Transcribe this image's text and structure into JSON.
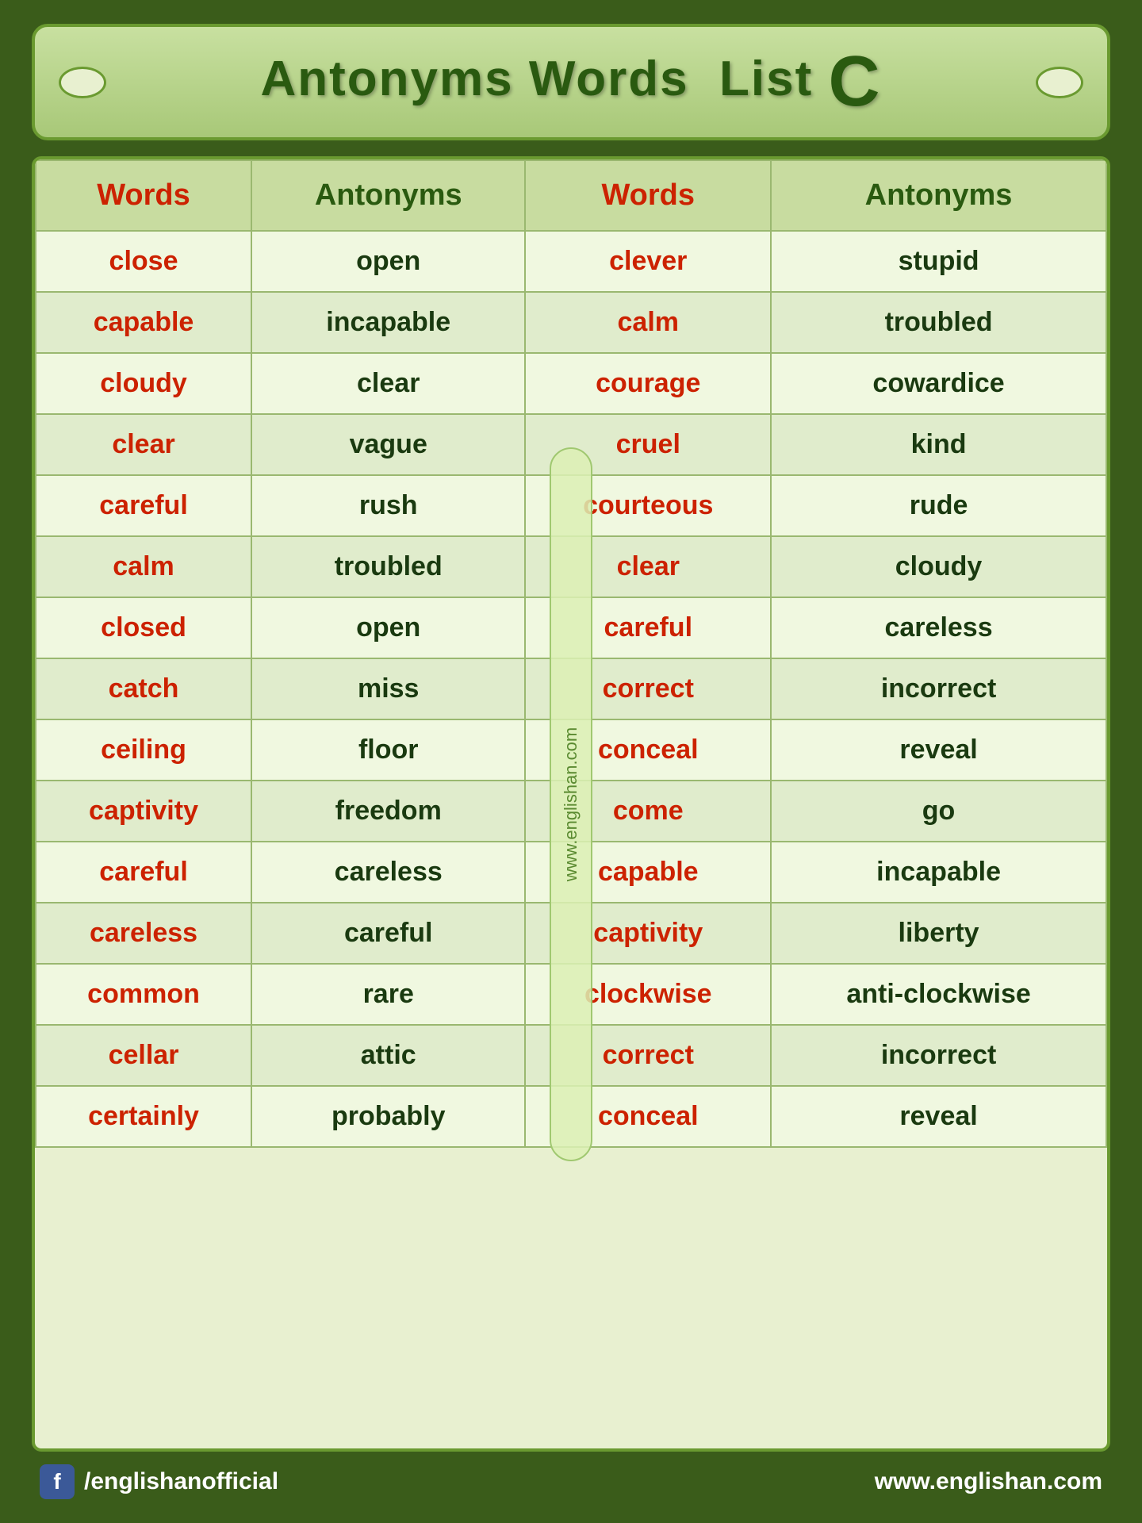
{
  "header": {
    "title": "Antonyms Words  List",
    "big_letter": "C"
  },
  "table": {
    "columns": [
      {
        "label": "Words",
        "type": "words"
      },
      {
        "label": "Antonyms",
        "type": "antonyms"
      },
      {
        "label": "Words",
        "type": "words"
      },
      {
        "label": "Antonyms",
        "type": "antonyms"
      }
    ],
    "rows": [
      [
        "close",
        "open",
        "clever",
        "stupid"
      ],
      [
        "capable",
        "incapable",
        "calm",
        "troubled"
      ],
      [
        "cloudy",
        "clear",
        "courage",
        "cowardice"
      ],
      [
        "clear",
        "vague",
        "cruel",
        "kind"
      ],
      [
        "careful",
        "rush",
        "courteous",
        "rude"
      ],
      [
        "calm",
        "troubled",
        "clear",
        "cloudy"
      ],
      [
        "closed",
        "open",
        "careful",
        "careless"
      ],
      [
        "catch",
        "miss",
        "correct",
        "incorrect"
      ],
      [
        "ceiling",
        "floor",
        "conceal",
        "reveal"
      ],
      [
        "captivity",
        "freedom",
        "come",
        "go"
      ],
      [
        "careful",
        "careless",
        "capable",
        "incapable"
      ],
      [
        "careless",
        "careful",
        "captivity",
        "liberty"
      ],
      [
        "common",
        "rare",
        "clockwise",
        "anti-clockwise"
      ],
      [
        "cellar",
        "attic",
        "correct",
        "incorrect"
      ],
      [
        "certainly",
        "probably",
        "conceal",
        "reveal"
      ]
    ]
  },
  "watermark": "www.englishan.com",
  "footer": {
    "facebook_handle": "/englishanofficial",
    "website": "www.englishan.com"
  }
}
